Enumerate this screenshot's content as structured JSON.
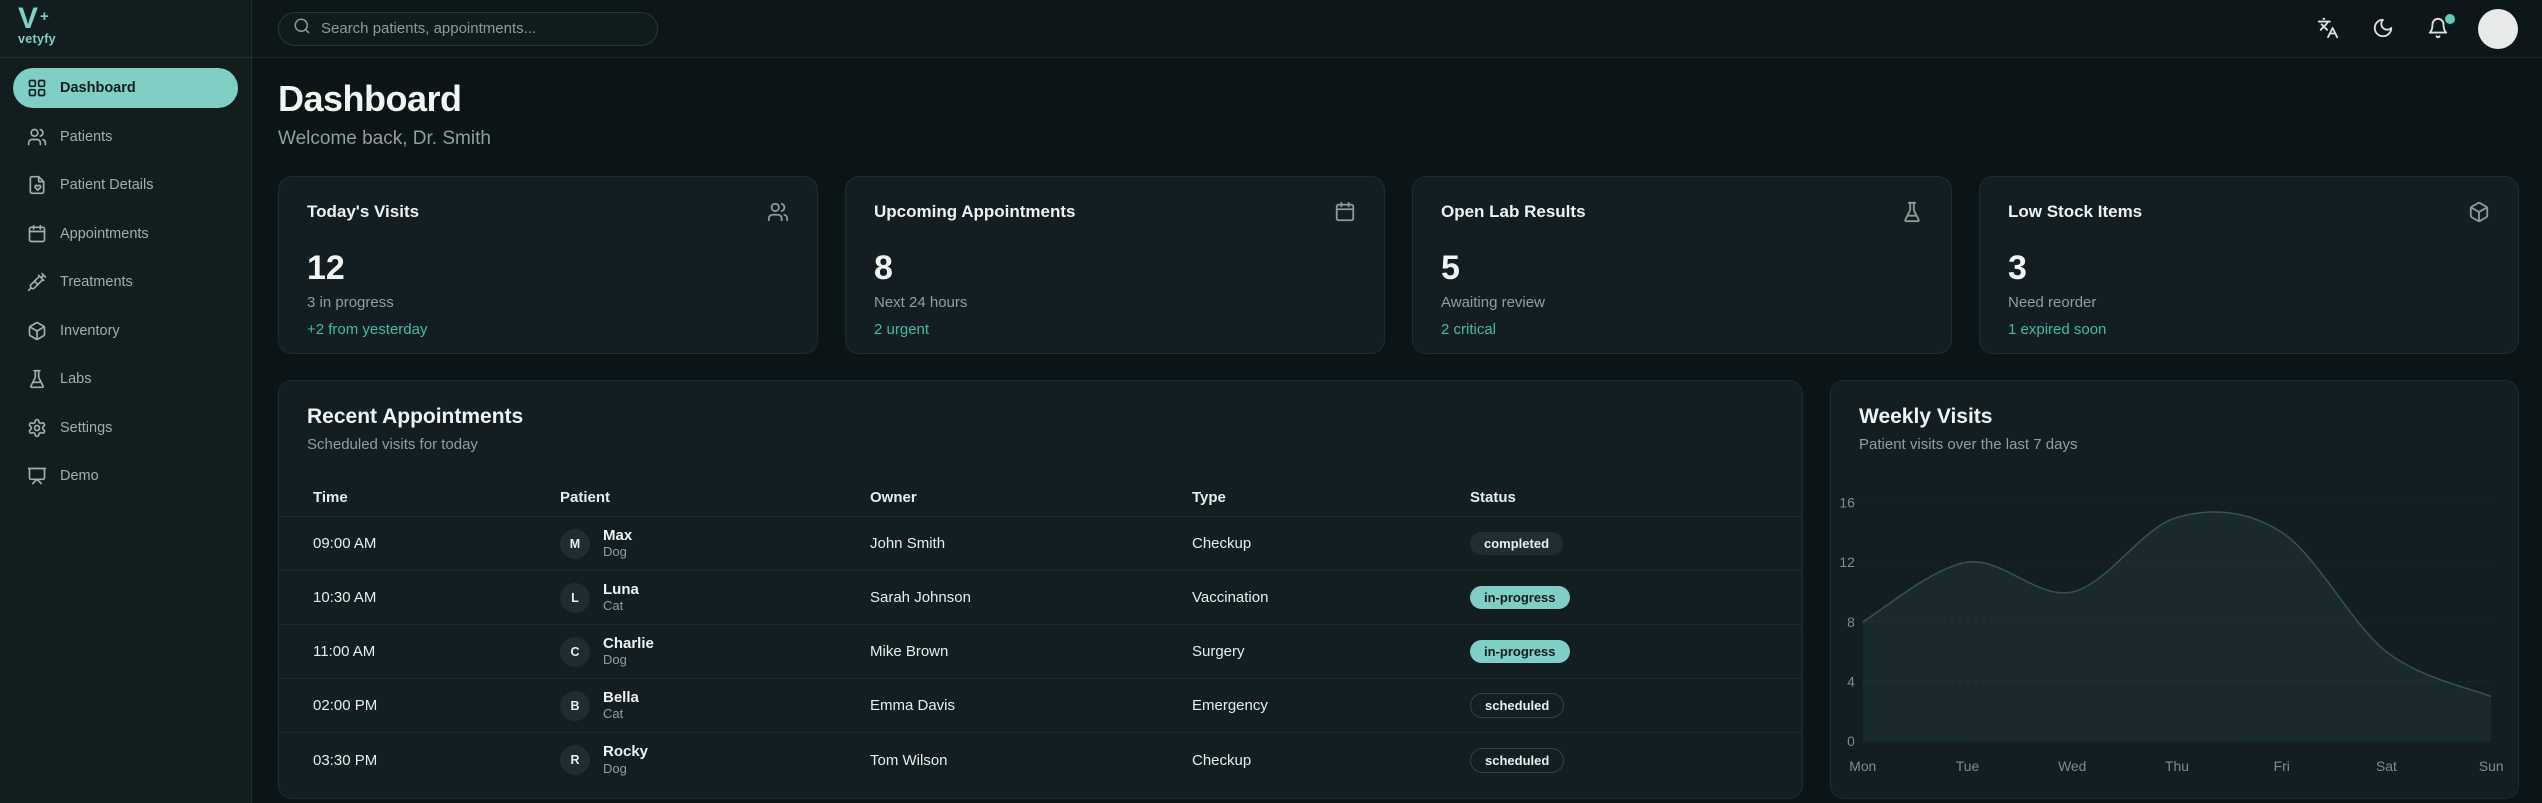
{
  "brand": {
    "name": "vetyfy",
    "logo_letter": "V",
    "logo_plus": "+"
  },
  "header": {
    "search_placeholder": "Search patients, appointments...",
    "has_notification_dot": true
  },
  "sidebar": {
    "items": [
      {
        "label": "Dashboard",
        "icon": "grid-icon",
        "active": true
      },
      {
        "label": "Patients",
        "icon": "users-icon",
        "active": false
      },
      {
        "label": "Patient Details",
        "icon": "file-heart-icon",
        "active": false
      },
      {
        "label": "Appointments",
        "icon": "calendar-icon",
        "active": false
      },
      {
        "label": "Treatments",
        "icon": "syringe-icon",
        "active": false
      },
      {
        "label": "Inventory",
        "icon": "package-icon",
        "active": false
      },
      {
        "label": "Labs",
        "icon": "flask-icon",
        "active": false
      },
      {
        "label": "Settings",
        "icon": "gear-icon",
        "active": false
      },
      {
        "label": "Demo",
        "icon": "presentation-icon",
        "active": false
      }
    ]
  },
  "page": {
    "title": "Dashboard",
    "subtitle": "Welcome back, Dr. Smith"
  },
  "stats": [
    {
      "title": "Today's Visits",
      "icon": "users-icon",
      "value": "12",
      "sub": "3 in progress",
      "note": "+2 from yesterday"
    },
    {
      "title": "Upcoming Appointments",
      "icon": "calendar-icon",
      "value": "8",
      "sub": "Next 24 hours",
      "note": "2 urgent"
    },
    {
      "title": "Open Lab Results",
      "icon": "flask-icon",
      "value": "5",
      "sub": "Awaiting review",
      "note": "2 critical"
    },
    {
      "title": "Low Stock Items",
      "icon": "package-icon",
      "value": "3",
      "sub": "Need reorder",
      "note": "1 expired soon"
    }
  ],
  "appointments": {
    "title": "Recent Appointments",
    "subtitle": "Scheduled visits for today",
    "columns": [
      "Time",
      "Patient",
      "Owner",
      "Type",
      "Status"
    ],
    "rows": [
      {
        "time": "09:00 AM",
        "initial": "M",
        "patient": "Max",
        "species": "Dog",
        "owner": "John Smith",
        "type": "Checkup",
        "status": "completed"
      },
      {
        "time": "10:30 AM",
        "initial": "L",
        "patient": "Luna",
        "species": "Cat",
        "owner": "Sarah Johnson",
        "type": "Vaccination",
        "status": "in-progress"
      },
      {
        "time": "11:00 AM",
        "initial": "C",
        "patient": "Charlie",
        "species": "Dog",
        "owner": "Mike Brown",
        "type": "Surgery",
        "status": "in-progress"
      },
      {
        "time": "02:00 PM",
        "initial": "B",
        "patient": "Bella",
        "species": "Cat",
        "owner": "Emma Davis",
        "type": "Emergency",
        "status": "scheduled"
      },
      {
        "time": "03:30 PM",
        "initial": "R",
        "patient": "Rocky",
        "species": "Dog",
        "owner": "Tom Wilson",
        "type": "Checkup",
        "status": "scheduled"
      }
    ]
  },
  "chart_data": {
    "type": "area",
    "title": "Weekly Visits",
    "subtitle": "Patient visits over the last 7 days",
    "categories": [
      "Mon",
      "Tue",
      "Wed",
      "Thu",
      "Fri",
      "Sat",
      "Sun"
    ],
    "values": [
      8,
      12,
      10,
      15,
      14,
      6,
      3
    ],
    "xlabel": "",
    "ylabel": "",
    "ylim": [
      0,
      16
    ],
    "yticks": [
      0,
      4,
      8,
      12,
      16
    ],
    "grid": "horizontal-dashed",
    "legend": "none"
  },
  "colors": {
    "accent": "#7fcfc4",
    "accent_text": "#41bba8",
    "page_bg": "#0b1416",
    "panel_bg": "#121e21",
    "sidebar_bg": "#111d1f",
    "notification_dot": "#5fc9b8"
  }
}
